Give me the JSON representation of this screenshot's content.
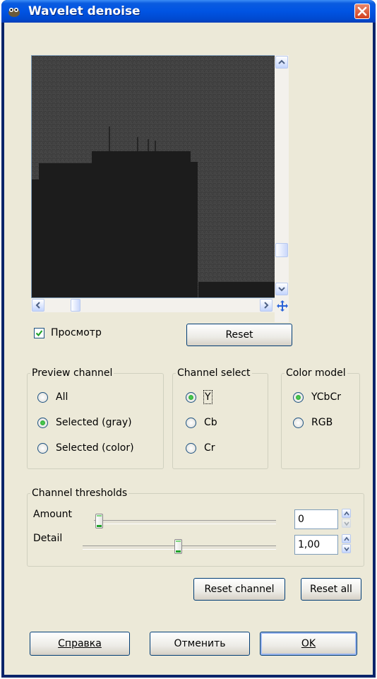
{
  "window": {
    "title": "Wavelet denoise"
  },
  "preview": {
    "checkbox_label": "Просмотр",
    "checkbox_checked": true,
    "reset_label": "Reset"
  },
  "preview_channel": {
    "legend": "Preview channel",
    "options": [
      {
        "label": "All",
        "selected": false
      },
      {
        "label": "Selected (gray)",
        "selected": true
      },
      {
        "label": "Selected (color)",
        "selected": false
      }
    ]
  },
  "channel_select": {
    "legend": "Channel select",
    "options": [
      {
        "label": "Y",
        "selected": true
      },
      {
        "label": "Cb",
        "selected": false
      },
      {
        "label": "Cr",
        "selected": false
      }
    ]
  },
  "color_model": {
    "legend": "Color model",
    "options": [
      {
        "label": "YCbCr",
        "selected": true
      },
      {
        "label": "RGB",
        "selected": false
      }
    ]
  },
  "thresholds": {
    "legend": "Channel thresholds",
    "amount": {
      "label": "Amount",
      "value": "0",
      "level": 0.0
    },
    "detail": {
      "label": "Detail",
      "value": "1,00",
      "level": 0.6
    }
  },
  "buttons": {
    "reset_channel": "Reset channel",
    "reset_all": "Reset all",
    "help": "Справка",
    "cancel": "Отменить",
    "ok": "OK"
  },
  "colors": {
    "titlebar": "#0054e3",
    "dialog_bg": "#ece9d8",
    "close_button": "#d2401e",
    "radio_selected": "#21a12a"
  },
  "icons": [
    "gimp-wilber-icon",
    "close-icon",
    "scroll-up-icon",
    "scroll-down-icon",
    "scroll-left-icon",
    "scroll-right-icon",
    "navigate-icon",
    "checkmark-icon",
    "spin-up-icon",
    "spin-down-icon"
  ]
}
